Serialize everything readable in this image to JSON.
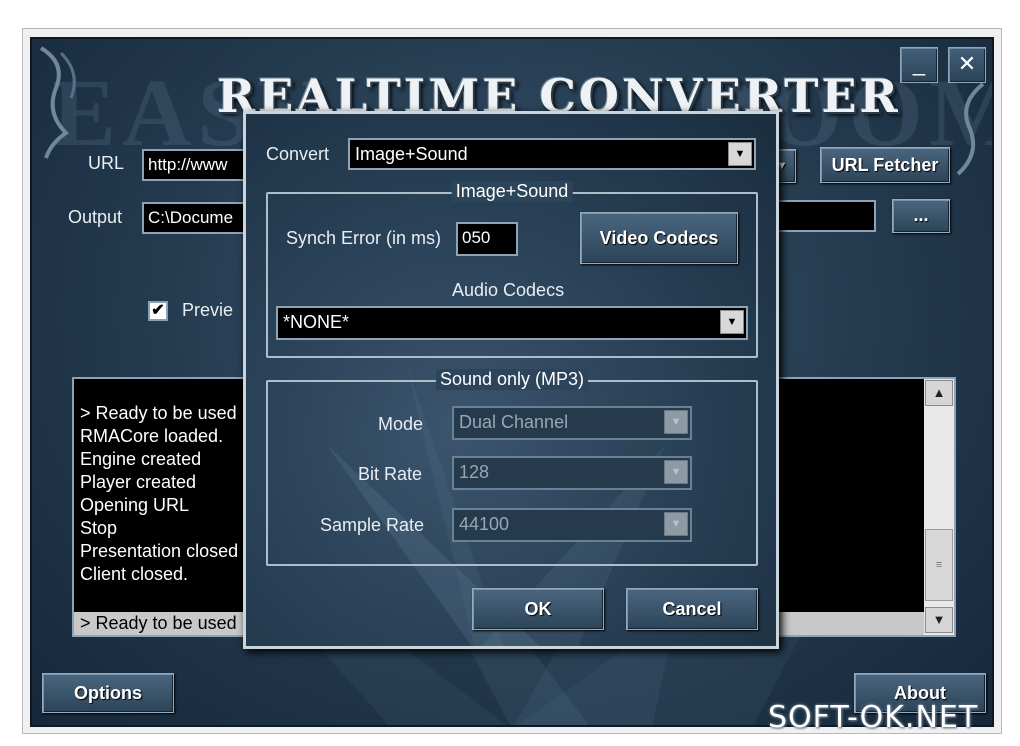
{
  "app": {
    "title": "REALTIME CONVERTER",
    "minimize_label": "_",
    "close_label": "✕",
    "url_label": "URL",
    "url_value": "http://www",
    "output_label": "Output",
    "output_value": "C:\\Docume",
    "browse_label": "...",
    "url_fetcher_label": "URL Fetcher",
    "preview_label": "Previe",
    "preview_checked": "✔",
    "options_label": "Options",
    "about_label": "About",
    "log_lines": [
      "> Ready to be used",
      "RMACore loaded.",
      "Engine created",
      "Player created",
      "Opening URL",
      "Stop",
      "Presentation closed",
      "Client closed."
    ],
    "log_selected": "> Ready to be used"
  },
  "dialog": {
    "convert_label": "Convert",
    "convert_value": "Image+Sound",
    "image_sound_group": "Image+Sound",
    "synch_error_label": "Synch Error (in ms)",
    "synch_error_value": "050",
    "video_codecs_label": "Video Codecs",
    "audio_codecs_label": "Audio Codecs",
    "audio_codecs_value": "*NONE*",
    "sound_only_group": "Sound only (MP3)",
    "mode_label": "Mode",
    "mode_value": "Dual Channel",
    "bitrate_label": "Bit Rate",
    "bitrate_value": "128",
    "samplerate_label": "Sample Rate",
    "samplerate_value": "44100",
    "ok_label": "OK",
    "cancel_label": "Cancel"
  },
  "watermark": {
    "text": "SOFT-OK.NET"
  },
  "icons": {
    "dropdown": "chevron-down-icon",
    "scroll_up": "chevron-up-icon",
    "scroll_down": "chevron-down-icon",
    "thumb_grip": "grip-icon"
  }
}
